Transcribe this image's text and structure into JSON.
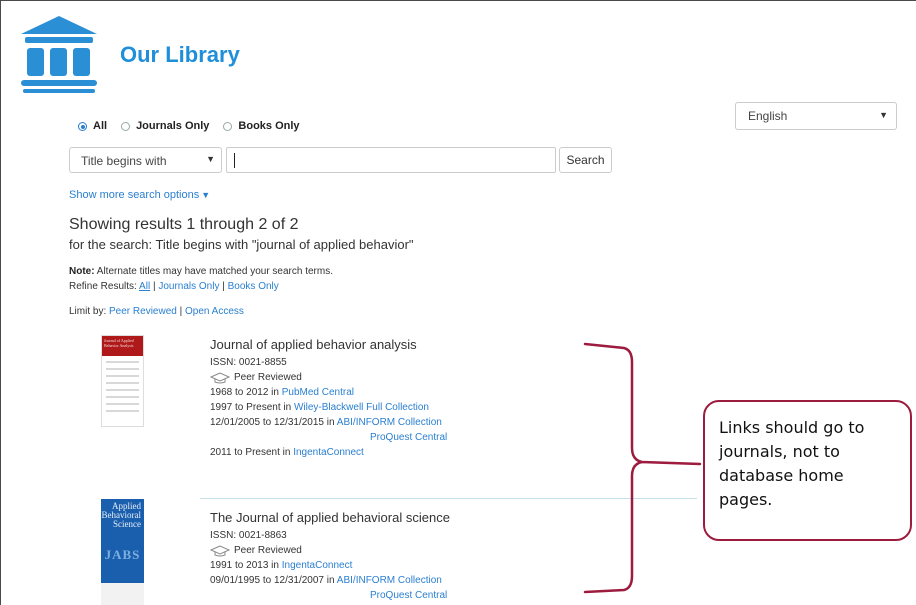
{
  "header": {
    "site_title": "Our Library"
  },
  "language": {
    "selected": "English"
  },
  "search": {
    "scope_options": [
      {
        "label": "All",
        "selected": true
      },
      {
        "label": "Journals Only",
        "selected": false
      },
      {
        "label": "Books Only",
        "selected": false
      }
    ],
    "field_selected": "Title begins with",
    "query_value": "",
    "button_label": "Search",
    "more_options_label": "Show more search options"
  },
  "results": {
    "heading": "Showing results 1 through 2 of 2",
    "query_text": "for the search: Title begins with \"journal of applied behavior\"",
    "note_label": "Note:",
    "note_text": " Alternate titles may have matched your search terms.",
    "refine_label": "Refine Results: ",
    "refine_links": [
      "All",
      "Journals Only",
      "Books Only"
    ],
    "limit_label": "Limit by: ",
    "limit_links": [
      "Peer Reviewed",
      "Open Access"
    ],
    "items": [
      {
        "title": "Journal of applied behavior analysis",
        "issn": "ISSN: 0021-8855",
        "peer": "Peer Reviewed",
        "cover_text": "Journal of Applied Behavior Analysis",
        "coverage": [
          {
            "range": "1968 to 2012 in ",
            "db": "PubMed Central"
          },
          {
            "range": "1997 to Present in ",
            "db": "Wiley-Blackwell Full Collection"
          },
          {
            "range": "12/01/2005 to 12/31/2015 in ",
            "db": "ABI/INFORM Collection"
          },
          {
            "range": "",
            "db": "ProQuest Central"
          },
          {
            "range": "2011 to Present in ",
            "db": "IngentaConnect"
          }
        ]
      },
      {
        "title": "The Journal of applied behavioral science",
        "issn": "ISSN: 0021-8863",
        "peer": "Peer Reviewed",
        "cover_text": "Applied Behavioral Science",
        "cover_abbrev": "JABS",
        "coverage": [
          {
            "range": "1991 to 2013 in ",
            "db": "IngentaConnect"
          },
          {
            "range": "09/01/1995 to 12/31/2007 in ",
            "db": "ABI/INFORM Collection"
          },
          {
            "range": "",
            "db": "ProQuest Central"
          }
        ]
      }
    ]
  },
  "annotation": {
    "text": "Links should go to journals, not to database home pages.",
    "color": "#9c1b3e"
  },
  "colors": {
    "brand": "#1f8fd9",
    "link": "#2a7fd0"
  }
}
